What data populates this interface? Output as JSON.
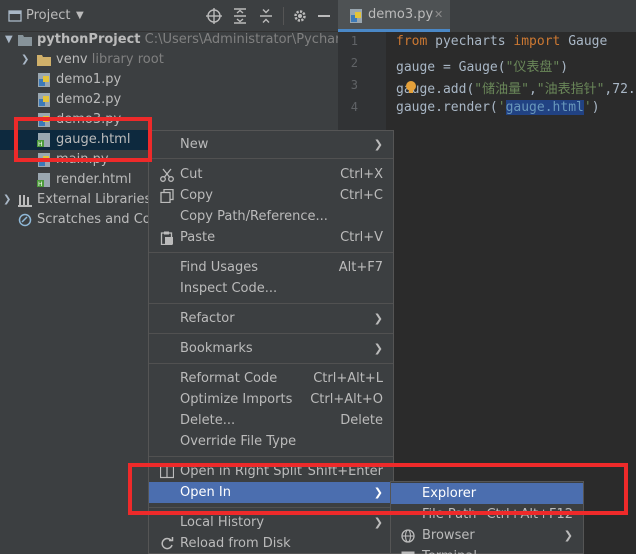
{
  "project_panel": {
    "title": "Project",
    "tree": [
      {
        "label": "pythonProject",
        "hint": "C:\\Users\\Administrator\\PycharmProj"
      },
      {
        "label": "venv",
        "hint": "library root"
      },
      {
        "label": "demo1.py"
      },
      {
        "label": "demo2.py"
      },
      {
        "label": "demo3.py"
      },
      {
        "label": "gauge.html"
      },
      {
        "label": "main.py"
      },
      {
        "label": "render.html"
      },
      {
        "label": "External Libraries"
      },
      {
        "label": "Scratches and Cons"
      }
    ]
  },
  "editor": {
    "tab_label": "demo3.py",
    "lines": [
      {
        "num": "1",
        "kw": "from",
        "rest1": " pyecharts ",
        "kw2": "import",
        "rest2": " Gauge"
      },
      {
        "num": "2",
        "a": "gauge = Gauge(",
        "s": "\"仪表盘\"",
        "b": ")"
      },
      {
        "num": "3",
        "a": "gauge.add(",
        "s1": "\"储油量\"",
        "c": ",",
        "s2": "\"油表指针\"",
        "d": ",72."
      },
      {
        "num": "4",
        "a": "gauge.render(",
        "q1": "'",
        "sel": "gauge.html",
        "q2": "'",
        "b": ")"
      }
    ]
  },
  "context_menu": {
    "new": "New",
    "cut": "Cut",
    "cut_sc": "Ctrl+X",
    "copy": "Copy",
    "copy_sc": "Ctrl+C",
    "copy_path": "Copy Path/Reference...",
    "paste": "Paste",
    "paste_sc": "Ctrl+V",
    "find_usages": "Find Usages",
    "find_usages_sc": "Alt+F7",
    "inspect_code": "Inspect Code...",
    "refactor": "Refactor",
    "bookmarks": "Bookmarks",
    "reformat": "Reformat Code",
    "reformat_sc": "Ctrl+Alt+L",
    "optimize": "Optimize Imports",
    "optimize_sc": "Ctrl+Alt+O",
    "delete": "Delete...",
    "delete_sc": "Delete",
    "override": "Override File Type",
    "open_right_split": "Open in Right Split",
    "open_right_split_sc": "Shift+Enter",
    "open_in": "Open In",
    "local_history": "Local History",
    "reload": "Reload from Disk"
  },
  "submenu": {
    "explorer": "Explorer",
    "file_path": "File Path",
    "file_path_sc": "Ctrl+Alt+F12",
    "browser": "Browser",
    "terminal": "Terminal"
  },
  "colors": {
    "highlight_red": "#ee2a2a",
    "menu_hover": "#4b6eaf",
    "tab_underline": "#4a88c7"
  }
}
